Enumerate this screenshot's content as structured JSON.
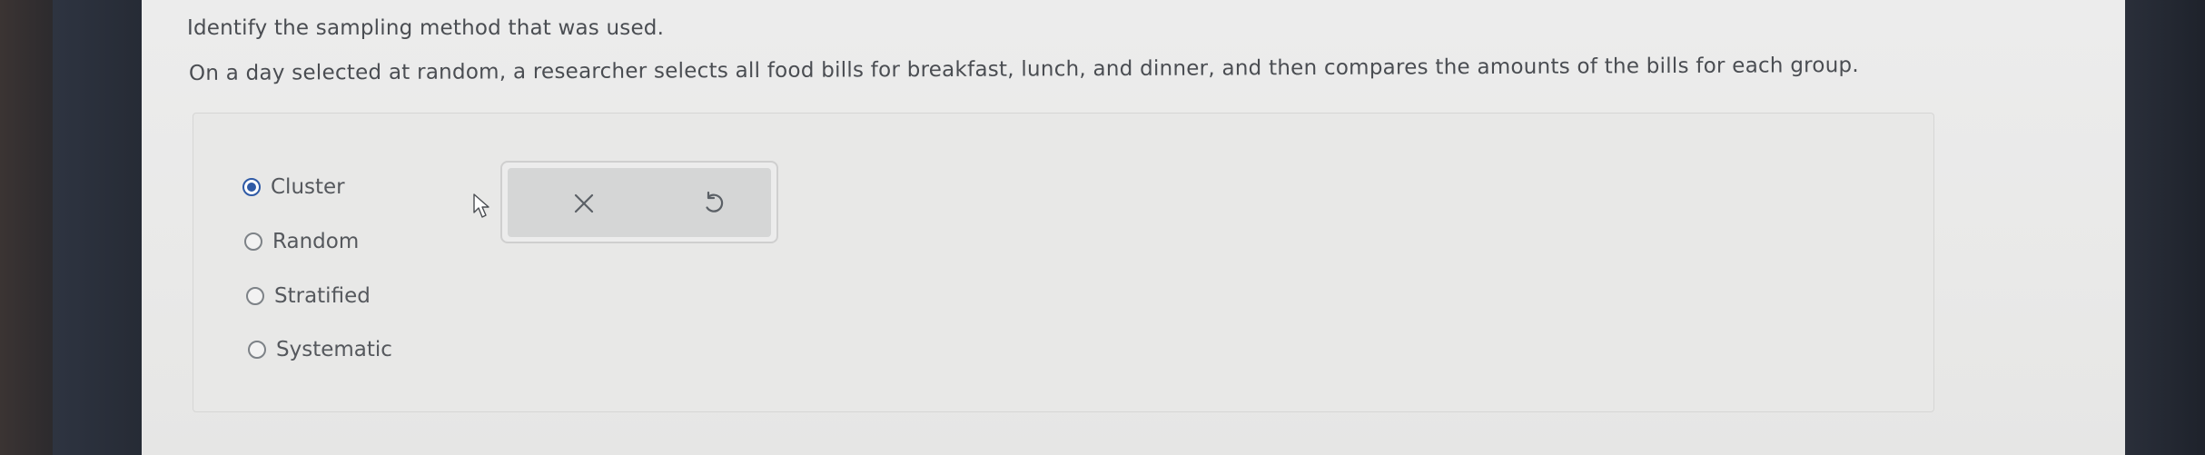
{
  "question": {
    "instruction": "Identify the sampling method that was used.",
    "prompt": "On a day selected at random, a researcher selects all food bills for breakfast, lunch, and dinner, and then compares the amounts of the bills for each group."
  },
  "options": [
    {
      "label": "Cluster",
      "selected": true
    },
    {
      "label": "Random",
      "selected": false
    },
    {
      "label": "Stratified",
      "selected": false
    },
    {
      "label": "Systematic",
      "selected": false
    }
  ],
  "actions": {
    "clear_icon": "close-icon",
    "reset_icon": "undo-icon"
  },
  "colors": {
    "radio_selected": "#2f5aa6",
    "text": "#4a4d52"
  }
}
